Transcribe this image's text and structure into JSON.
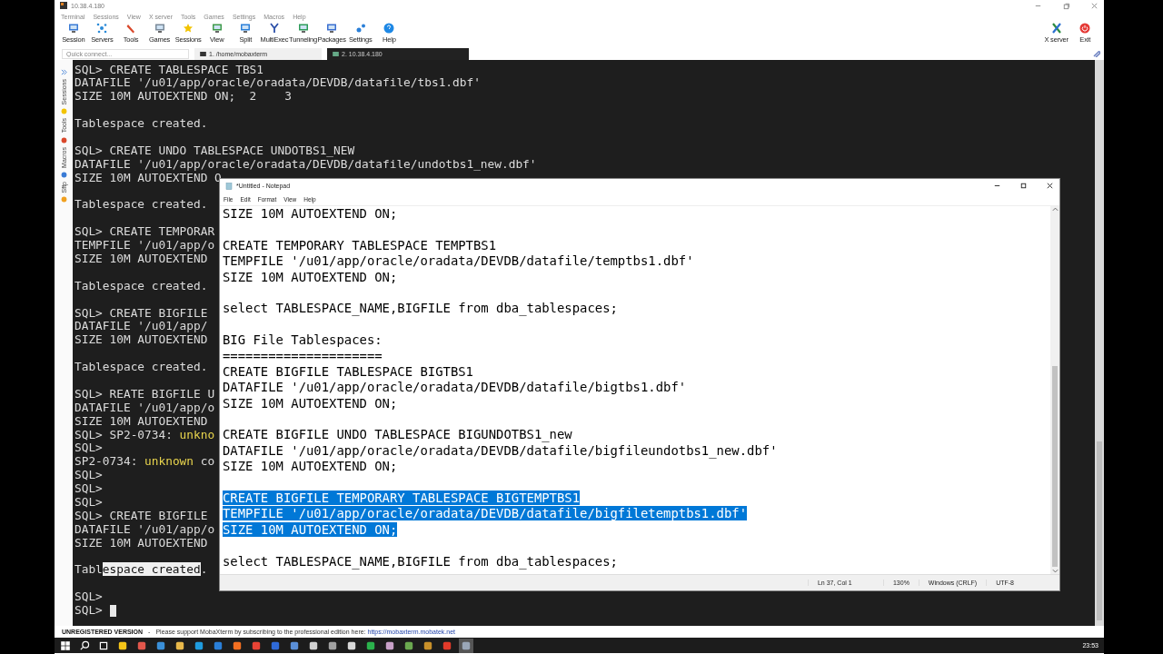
{
  "window": {
    "title": "10.38.4.180"
  },
  "menu": [
    "Terminal",
    "Sessions",
    "View",
    "X server",
    "Tools",
    "Games",
    "Settings",
    "Macros",
    "Help"
  ],
  "toolbar": [
    "Session",
    "Servers",
    "Tools",
    "Games",
    "Sessions",
    "View",
    "Split",
    "MultiExec",
    "Tunneling",
    "Packages",
    "Settings",
    "Help"
  ],
  "toolbar_right": [
    "X server",
    "Exit"
  ],
  "quick_connect": {
    "placeholder": "Quick connect..."
  },
  "tabs": [
    {
      "label": "1. /home/mobaxterm",
      "selected": false
    },
    {
      "label": "2. 10.38.4.180",
      "selected": true
    }
  ],
  "sidebar": [
    "Sessions",
    "Tools",
    "Macros",
    "Sftp"
  ],
  "terminal": [
    {
      "kind": "text",
      "text": "SQL> CREATE TABLESPACE TBS1"
    },
    {
      "kind": "text",
      "text": "DATAFILE '/u01/app/oracle/oradata/DEVDB/datafile/tbs1.dbf'"
    },
    {
      "kind": "text",
      "text": "SIZE 10M AUTOEXTEND ON;  2    3"
    },
    {
      "kind": "blank"
    },
    {
      "kind": "text",
      "text": "Tablespace created."
    },
    {
      "kind": "blank"
    },
    {
      "kind": "text",
      "text": "SQL> CREATE UNDO TABLESPACE UNDOTBS1_NEW"
    },
    {
      "kind": "text",
      "text": "DATAFILE '/u01/app/oracle/oradata/DEVDB/datafile/undotbs1_new.dbf'"
    },
    {
      "kind": "text",
      "text": "SIZE 10M AUTOEXTEND O"
    },
    {
      "kind": "blank"
    },
    {
      "kind": "text",
      "text": "Tablespace created."
    },
    {
      "kind": "blank"
    },
    {
      "kind": "text",
      "text": "SQL> CREATE TEMPORAR"
    },
    {
      "kind": "text",
      "text": "TEMPFILE '/u01/app/o"
    },
    {
      "kind": "text",
      "text": "SIZE 10M AUTOEXTEND"
    },
    {
      "kind": "blank"
    },
    {
      "kind": "text",
      "text": "Tablespace created."
    },
    {
      "kind": "blank"
    },
    {
      "kind": "text",
      "text": "SQL> CREATE BIGFILE"
    },
    {
      "kind": "text",
      "text": "DATAFILE '/u01/app/"
    },
    {
      "kind": "text",
      "text": "SIZE 10M AUTOEXTEND"
    },
    {
      "kind": "blank"
    },
    {
      "kind": "text",
      "text": "Tablespace created."
    },
    {
      "kind": "blank"
    },
    {
      "kind": "text",
      "text": "SQL> REATE BIGFILE U"
    },
    {
      "kind": "text",
      "text": "DATAFILE '/u01/app/o"
    },
    {
      "kind": "text",
      "text": "SIZE 10M AUTOEXTEND"
    },
    {
      "kind": "parts",
      "parts": [
        {
          "kind": "plain",
          "text": "SQL> SP2-0734:"
        },
        {
          "kind": "warning",
          "text": "unkno"
        }
      ]
    },
    {
      "kind": "text",
      "text": "SQL>"
    },
    {
      "kind": "parts",
      "parts": [
        {
          "kind": "plain",
          "text": "SP2-0734:"
        },
        {
          "kind": "warning",
          "text": "unknown"
        },
        {
          "kind": "plain",
          "text": "co"
        }
      ]
    },
    {
      "kind": "text",
      "text": "SQL>"
    },
    {
      "kind": "text",
      "text": "SQL>"
    },
    {
      "kind": "text",
      "text": "SQL>"
    },
    {
      "kind": "text",
      "text": "SQL> CREATE BIGFILE"
    },
    {
      "kind": "text",
      "text": "DATAFILE '/u01/app/o"
    },
    {
      "kind": "text",
      "text": "SIZE 10M AUTOEXTEND"
    },
    {
      "kind": "blank"
    },
    {
      "kind": "parts",
      "parts": [
        {
          "kind": "plain",
          "text": "Tabl"
        },
        {
          "kind": "highlight",
          "text": "espace created"
        },
        {
          "kind": "plain",
          "text": "."
        }
      ]
    },
    {
      "kind": "blank"
    },
    {
      "kind": "text",
      "text": "SQL>"
    },
    {
      "kind": "cursor",
      "text": "SQL>"
    }
  ],
  "notepad": {
    "title": "*Untitled - Notepad",
    "menu": [
      "File",
      "Edit",
      "Format",
      "View",
      "Help"
    ],
    "lines": [
      {
        "kind": "text",
        "text": "SIZE 10M AUTOEXTEND ON;",
        "selected": false
      },
      {
        "kind": "blank",
        "selected": false
      },
      {
        "kind": "text",
        "text": "CREATE TEMPORARY TABLESPACE TEMPTBS1",
        "selected": false
      },
      {
        "kind": "text",
        "text": "TEMPFILE '/u01/app/oracle/oradata/DEVDB/datafile/temptbs1.dbf'",
        "selected": false
      },
      {
        "kind": "text",
        "text": "SIZE 10M AUTOEXTEND ON;",
        "selected": false
      },
      {
        "kind": "blank",
        "selected": false
      },
      {
        "kind": "text",
        "text": "select TABLESPACE_NAME,BIGFILE from dba_tablespaces;",
        "selected": false
      },
      {
        "kind": "blank",
        "selected": false
      },
      {
        "kind": "text",
        "text": "BIG File Tablespaces:",
        "selected": false
      },
      {
        "kind": "text",
        "text": "=====================",
        "selected": false
      },
      {
        "kind": "text",
        "text": "CREATE BIGFILE TABLESPACE BIGTBS1",
        "selected": false
      },
      {
        "kind": "text",
        "text": "DATAFILE '/u01/app/oracle/oradata/DEVDB/datafile/bigtbs1.dbf'",
        "selected": false
      },
      {
        "kind": "text",
        "text": "SIZE 10M AUTOEXTEND ON;",
        "selected": false
      },
      {
        "kind": "blank",
        "selected": false
      },
      {
        "kind": "text",
        "text": "CREATE BIGFILE UNDO TABLESPACE BIGUNDOTBS1_new",
        "selected": false
      },
      {
        "kind": "text",
        "text": "DATAFILE '/u01/app/oracle/oradata/DEVDB/datafile/bigfileundotbs1_new.dbf'",
        "selected": false
      },
      {
        "kind": "text",
        "text": "SIZE 10M AUTOEXTEND ON;",
        "selected": false
      },
      {
        "kind": "blank",
        "selected": false
      },
      {
        "kind": "text",
        "text": "CREATE BIGFILE TEMPORARY TABLESPACE BIGTEMPTBS1",
        "selected": true
      },
      {
        "kind": "text",
        "text": "TEMPFILE '/u01/app/oracle/oradata/DEVDB/datafile/bigfiletemptbs1.dbf'",
        "selected": true
      },
      {
        "kind": "text",
        "text": "SIZE 10M AUTOEXTEND ON;",
        "selected": true
      },
      {
        "kind": "blank",
        "selected": false
      },
      {
        "kind": "text",
        "text": "select TABLESPACE_NAME,BIGFILE from dba_tablespaces;",
        "selected": false
      }
    ],
    "status": [
      "Ln 37, Col 1",
      "130%",
      "Windows (CRLF)",
      "UTF-8"
    ]
  },
  "footer": {
    "label": "UNREGISTERED VERSION",
    "separator": "-",
    "message": "Please support MobaXterm by subscribing to the professional edition here:",
    "link": "https://mobaxterm.mobatek.net"
  },
  "clock": "23:53"
}
